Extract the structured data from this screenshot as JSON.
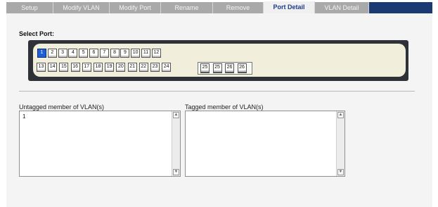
{
  "tabs": [
    {
      "label": "Setup",
      "active": false
    },
    {
      "label": "Modify VLAN",
      "active": false
    },
    {
      "label": "Modify Port",
      "active": false
    },
    {
      "label": "Rename",
      "active": false
    },
    {
      "label": "Remove",
      "active": false
    },
    {
      "label": "Port Detail",
      "active": true
    },
    {
      "label": "VLAN Detail",
      "active": false
    }
  ],
  "select_port": {
    "label": "Select Port:",
    "selected": "1",
    "row1": [
      "1",
      "2",
      "3",
      "4",
      "5",
      "6",
      "7",
      "8",
      "9",
      "10",
      "11",
      "12"
    ],
    "row2": [
      "13",
      "14",
      "15",
      "16",
      "17",
      "18",
      "19",
      "20",
      "21",
      "22",
      "23",
      "24"
    ],
    "sfp": [
      "25",
      "25",
      "26",
      "26"
    ]
  },
  "untagged": {
    "label": "Untagged member of VLAN(s)",
    "value": "1"
  },
  "tagged": {
    "label": "Tagged member of VLAN(s)",
    "value": ""
  },
  "scroll": {
    "up_glyph": "▲",
    "down_glyph": "▼"
  },
  "colors": {
    "tabbar": "#1a3a73",
    "tab_inactive": "#a9a9a9",
    "tab_active_text": "#1b3a8c",
    "port_selected": "#1e5ed6",
    "panel_dark": "#2f3138",
    "panel_light": "#f1eedc"
  }
}
